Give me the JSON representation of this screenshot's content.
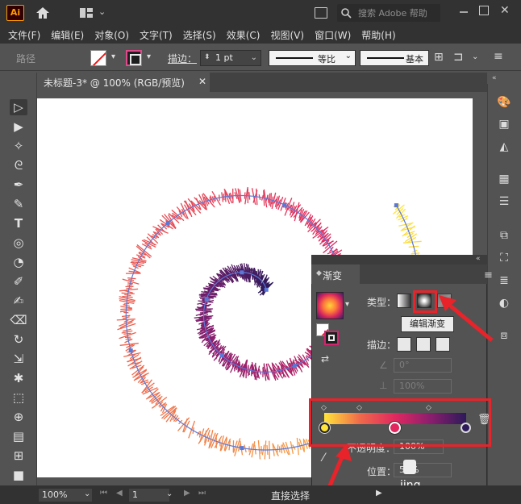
{
  "app": {
    "logo": "Ai"
  },
  "search": {
    "placeholder": "搜索 Adobe 帮助"
  },
  "menus": [
    "文件(F)",
    "编辑(E)",
    "对象(O)",
    "文字(T)",
    "选择(S)",
    "效果(C)",
    "视图(V)",
    "窗口(W)",
    "帮助(H)"
  ],
  "control": {
    "selection_type": "路径",
    "stroke_label": "描边：",
    "stroke_weight": "1 pt",
    "profile": "等比",
    "brush": "基本"
  },
  "document": {
    "tab_title": "未标题-3* @ 100% (RGB/预览)"
  },
  "gradient_panel": {
    "title": "渐变",
    "type_label": "类型：",
    "edit_gradient_tooltip": "编辑渐变",
    "stroke_label": "描边：",
    "angle": "0°",
    "aspect_ratio": "100%",
    "opacity_label": "不透明度：",
    "opacity": "100%",
    "position_label": "位置：",
    "position": "50%",
    "watermark": "jing",
    "stops": [
      "#ffe43a",
      "#e0285f",
      "#2c1a5a"
    ]
  },
  "status": {
    "zoom": "100%",
    "page": "1",
    "tool": "直接选择"
  },
  "colors": {
    "highlight": "#e8232a",
    "accent_logo": "#ff9a00"
  }
}
